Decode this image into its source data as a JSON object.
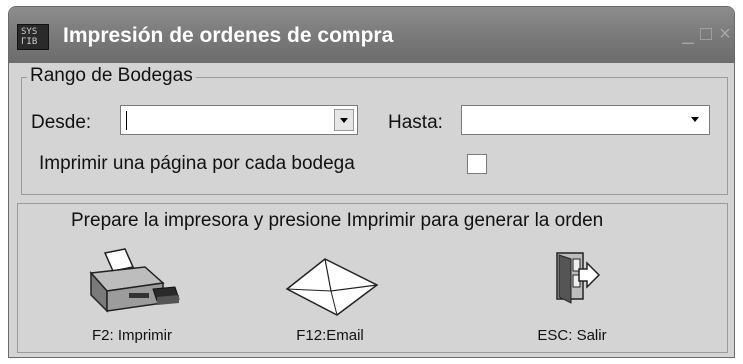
{
  "window": {
    "title": "Impresión de ordenes de compra",
    "icon": "app-logo-icon",
    "controls": [
      "minimize-icon",
      "maximize-icon",
      "close-icon"
    ]
  },
  "range": {
    "legend": "Rango de Bodegas",
    "from_label": "Desde:",
    "from_value": "",
    "to_label": "Hasta:",
    "to_value": "",
    "per_store_label": "Imprimir una página por cada bodega",
    "per_store_checked": false
  },
  "message": "Prepare la impresora y presione Imprimir para generar la orden",
  "actions": [
    {
      "label": "F2: Imprimir",
      "icon": "printer-icon"
    },
    {
      "label": "F12:Email",
      "icon": "envelope-icon"
    },
    {
      "label": "ESC: Salir",
      "icon": "exit-door-icon"
    }
  ]
}
